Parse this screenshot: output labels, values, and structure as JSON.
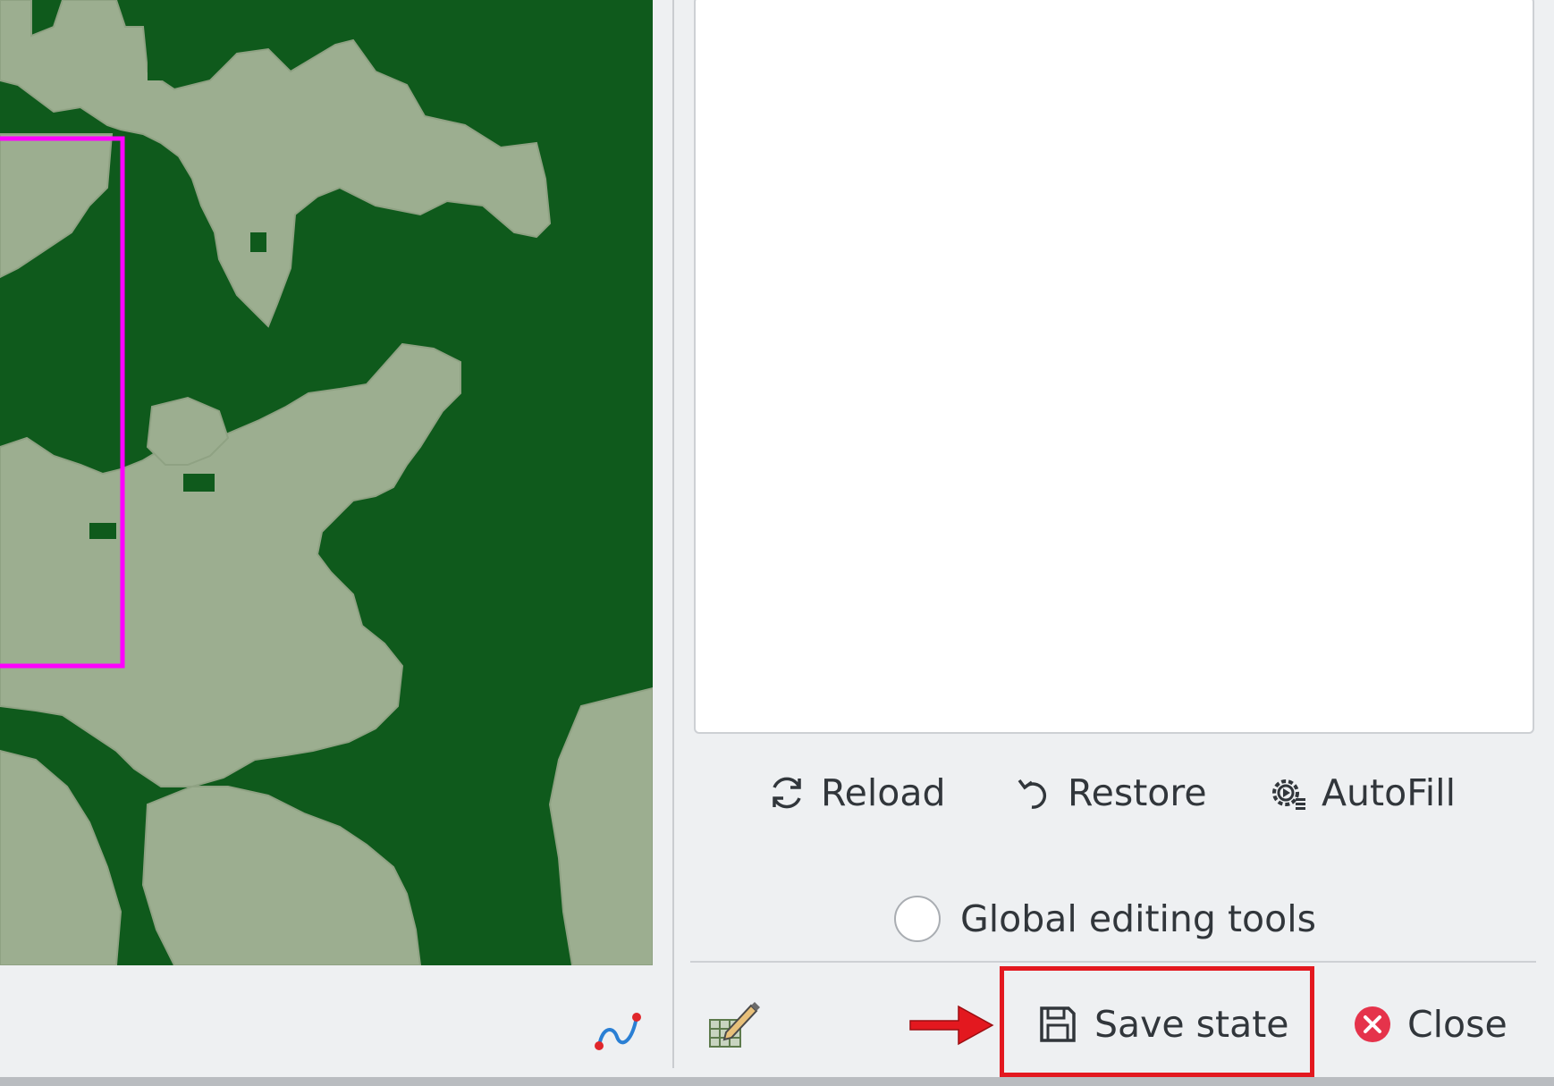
{
  "map": {
    "forest_color": "#0f5a1c",
    "cleared_color": "#9cae90",
    "selection_color": "#ff00ff",
    "curve_icon": "curve-tool-icon"
  },
  "panel": {
    "actions": {
      "reload_label": "Reload",
      "reload_icon": "refresh-icon",
      "restore_label": "Restore",
      "restore_icon": "undo-icon",
      "autofill_label": "AutoFill",
      "autofill_icon": "gear-play-icon"
    },
    "global_editing_tools": {
      "label": "Global editing tools",
      "checked": false
    },
    "footer": {
      "editor_icon": "table-edit-icon",
      "save_label": "Save state",
      "save_icon": "floppy-disk-icon",
      "close_label": "Close",
      "close_icon": "close-circle-icon"
    }
  },
  "annotation": {
    "arrow_color": "#e3181f",
    "highlight_color": "#e3181f"
  }
}
